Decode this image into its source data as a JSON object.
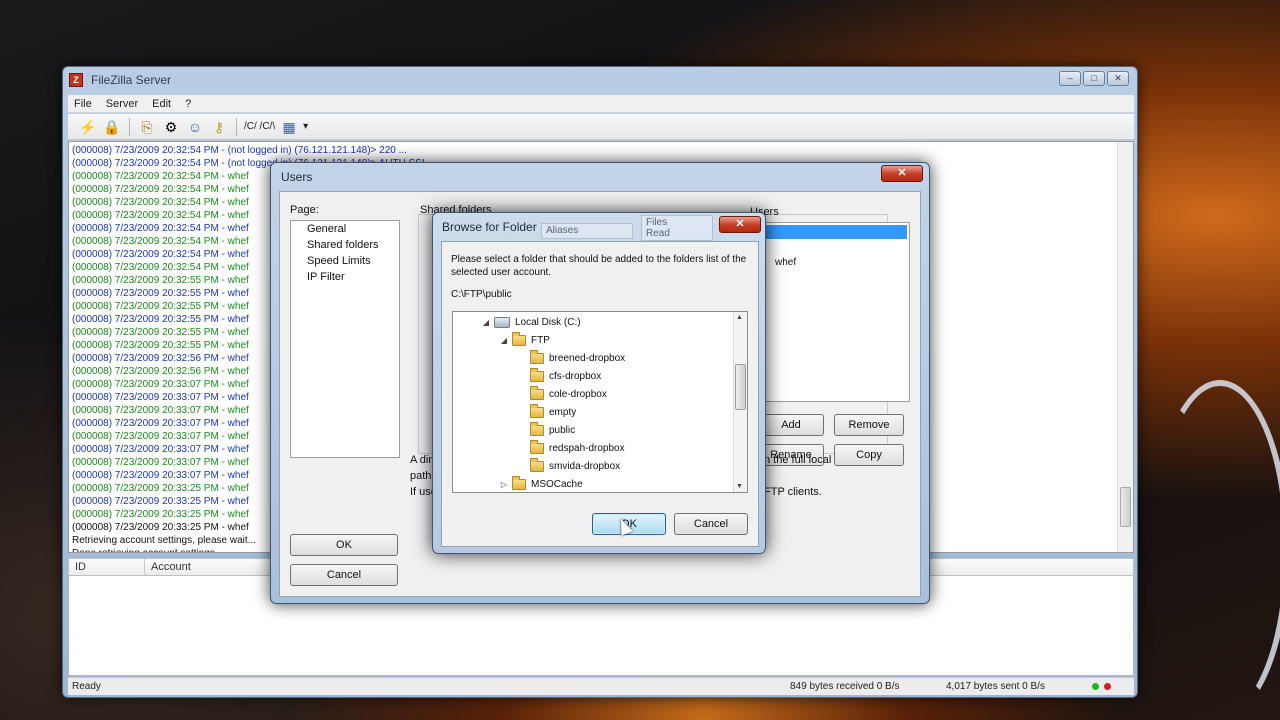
{
  "main_window": {
    "title": "FileZilla Server",
    "app_icon_letter": "Z",
    "controls": [
      "–",
      "□",
      "✕"
    ]
  },
  "menu": [
    "File",
    "Server",
    "Edit",
    "?"
  ],
  "toolbar": {
    "icons": [
      "lightning-icon",
      "lock-icon",
      "connect-icon",
      "settings-icon",
      "users-icon",
      "key-icon"
    ],
    "path_text": "/C/ /C/\\"
  },
  "log": {
    "lines": [
      {
        "text": "(000008) 7/23/2009 20:32:54 PM - (not logged in) (76.121.121.148)> 220 ...",
        "color": "blue"
      },
      {
        "text": "(000008) 7/23/2009 20:32:54 PM - (not logged in) (76.121.121.148)> AUTH SSL",
        "color": "blue"
      },
      {
        "text": "(000008) 7/23/2009 20:32:54 PM - whef",
        "color": "green"
      },
      {
        "text": "(000008) 7/23/2009 20:32:54 PM - whef",
        "color": "green"
      },
      {
        "text": "(000008) 7/23/2009 20:32:54 PM - whef",
        "color": "green"
      },
      {
        "text": "(000008) 7/23/2009 20:32:54 PM - whef",
        "color": "green"
      },
      {
        "text": "(000008) 7/23/2009 20:32:54 PM - whef",
        "color": "blue"
      },
      {
        "text": "(000008) 7/23/2009 20:32:54 PM - whef",
        "color": "green"
      },
      {
        "text": "(000008) 7/23/2009 20:32:54 PM - whef",
        "color": "blue"
      },
      {
        "text": "(000008) 7/23/2009 20:32:54 PM - whef",
        "color": "green"
      },
      {
        "text": "(000008) 7/23/2009 20:32:55 PM - whef",
        "color": "green"
      },
      {
        "text": "(000008) 7/23/2009 20:32:55 PM - whef",
        "color": "blue"
      },
      {
        "text": "(000008) 7/23/2009 20:32:55 PM - whef",
        "color": "green"
      },
      {
        "text": "(000008) 7/23/2009 20:32:55 PM - whef",
        "color": "blue"
      },
      {
        "text": "(000008) 7/23/2009 20:32:55 PM - whef",
        "color": "green"
      },
      {
        "text": "(000008) 7/23/2009 20:32:55 PM - whef",
        "color": "green"
      },
      {
        "text": "(000008) 7/23/2009 20:32:56 PM - whef",
        "color": "blue"
      },
      {
        "text": "(000008) 7/23/2009 20:32:56 PM - whef",
        "color": "green"
      },
      {
        "text": "(000008) 7/23/2009 20:33:07 PM - whef",
        "color": "green"
      },
      {
        "text": "(000008) 7/23/2009 20:33:07 PM - whef",
        "color": "blue"
      },
      {
        "text": "(000008) 7/23/2009 20:33:07 PM - whef",
        "color": "green"
      },
      {
        "text": "(000008) 7/23/2009 20:33:07 PM - whef",
        "color": "blue"
      },
      {
        "text": "(000008) 7/23/2009 20:33:07 PM - whef",
        "color": "green"
      },
      {
        "text": "(000008) 7/23/2009 20:33:07 PM - whef",
        "color": "blue"
      },
      {
        "text": "(000008) 7/23/2009 20:33:07 PM - whef",
        "color": "green"
      },
      {
        "text": "(000008) 7/23/2009 20:33:07 PM - whef",
        "color": "blue"
      },
      {
        "text": "(000008) 7/23/2009 20:33:25 PM - whef",
        "color": "green"
      },
      {
        "text": "(000008) 7/23/2009 20:33:25 PM - whef",
        "color": "blue"
      },
      {
        "text": "(000008) 7/23/2009 20:33:25 PM - whef",
        "color": "green"
      },
      {
        "text": "(000008) 7/23/2009 20:33:25 PM - whef",
        "color": "black"
      },
      {
        "text": "Retrieving account settings, please wait...",
        "color": "black"
      },
      {
        "text": "Done retrieving account settings",
        "color": "black"
      }
    ]
  },
  "queue": {
    "columns": [
      "ID",
      "Account"
    ]
  },
  "statusbar": {
    "ready": "Ready",
    "received": "849 bytes received  0 B/s",
    "sent": "4,017 bytes sent  0 B/s",
    "led_colors": [
      "#1fb51f",
      "#d21f1f"
    ]
  },
  "users_dialog": {
    "title": "Users",
    "close": "✕",
    "page_label": "Page:",
    "pages": [
      "General",
      "Shared folders",
      "Speed Limits",
      "IP Filter"
    ],
    "shared_label": "Shared folders",
    "users_label": "Users",
    "user_fragments": [
      "whef"
    ],
    "buttons": {
      "add": "Add",
      "remove": "Remove",
      "rename": "Rename",
      "copy": "Copy",
      "ok": "OK",
      "cancel": "Cancel"
    },
    "bg_text": {
      "a_dir": "A dir",
      "path": "path",
      "if_use": "If use",
      "full_local": "n the full local",
      "ftp_clients": "FTP clients."
    }
  },
  "browse_dialog": {
    "title": "Browse for Folder",
    "close": "✕",
    "ghost_aliases": "Aliases",
    "ghost_files": "Files",
    "ghost_read": "Read",
    "description": "Please select a folder that should be added to the folders list of the selected user account.",
    "path": "C:\\FTP\\public",
    "tree": [
      {
        "label": "Local Disk (C:)",
        "type": "drive",
        "expander": "◢"
      },
      {
        "label": "FTP",
        "type": "folder",
        "expander": "◢"
      },
      {
        "label": "breened-dropbox",
        "type": "folder",
        "expander": ""
      },
      {
        "label": "cfs-dropbox",
        "type": "folder",
        "expander": ""
      },
      {
        "label": "cole-dropbox",
        "type": "folder",
        "expander": ""
      },
      {
        "label": "empty",
        "type": "folder",
        "expander": ""
      },
      {
        "label": "public",
        "type": "folder",
        "expander": ""
      },
      {
        "label": "redspah-dropbox",
        "type": "folder",
        "expander": ""
      },
      {
        "label": "smvida-dropbox",
        "type": "folder",
        "expander": ""
      },
      {
        "label": "MSOCache",
        "type": "folder",
        "expander": "▷"
      }
    ],
    "ok": "OK",
    "cancel": "Cancel"
  }
}
